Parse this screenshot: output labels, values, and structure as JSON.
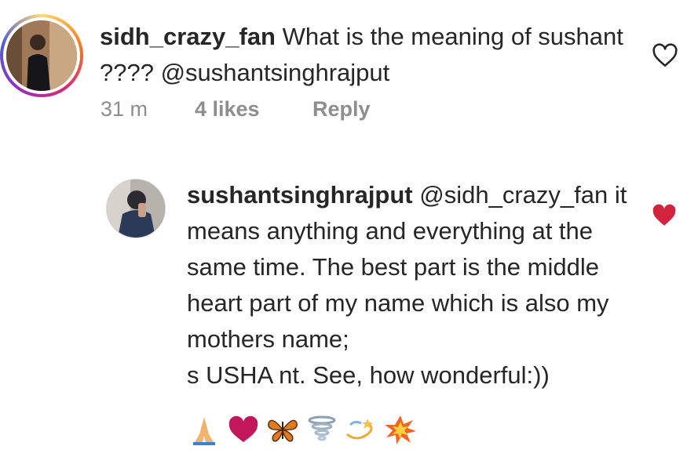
{
  "comments": [
    {
      "username": "sidh_crazy_fan",
      "text": "What is the meaning of sushant ???? @sushantsinghrajput",
      "time": "31 m",
      "likes": "4 likes",
      "reply_label": "Reply",
      "liked": false,
      "heart_icon": "heart-outline-icon"
    },
    {
      "username": "sushantsinghrajput",
      "text": "@sidh_crazy_fan it means anything and everything at the same time. The best part is the middle heart part of my name which is also my mothers name;",
      "text_line2": "s USHA nt. See, how wonderful:))",
      "liked": true,
      "heart_icon": "heart-filled-icon",
      "emojis": [
        "folded-hands-icon",
        "heart-icon",
        "butterfly-icon",
        "tornado-icon",
        "dizzy-icon",
        "collision-icon"
      ]
    }
  ],
  "colors": {
    "text": "#262626",
    "meta": "#8e8e8e",
    "like_red": "#ed4956"
  }
}
